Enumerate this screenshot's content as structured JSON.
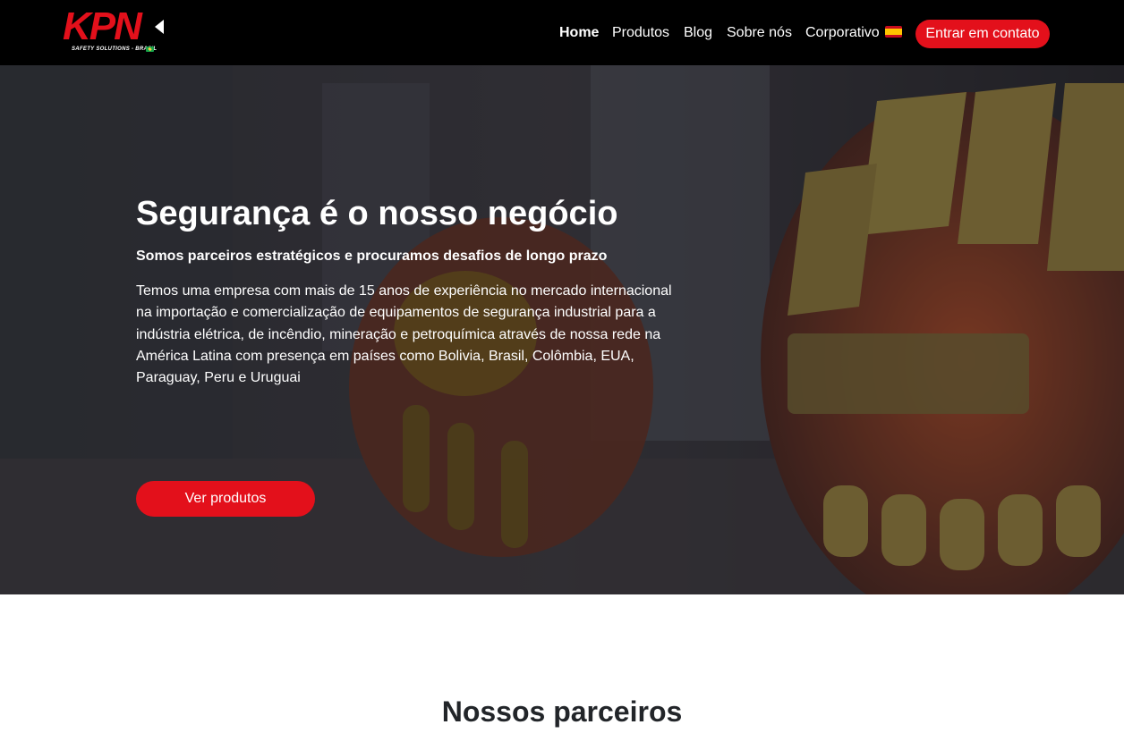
{
  "brand": {
    "logo_text": "KPN",
    "logo_tagline": "SAFETY SOLUTIONS - BRASIL",
    "primary_color": "#e3101b",
    "nav_background": "#000000"
  },
  "nav": {
    "items": [
      {
        "label": "Home",
        "active": true
      },
      {
        "label": "Produtos",
        "active": false
      },
      {
        "label": "Blog",
        "active": false
      },
      {
        "label": "Sobre nós",
        "active": false
      },
      {
        "label": "Corporativo",
        "active": false,
        "icon": "spain-flag-icon"
      }
    ],
    "cta_label": "Entrar em contato"
  },
  "hero": {
    "title": "Segurança é o nosso negócio",
    "subtitle": "Somos parceiros estratégicos e procuramos desafios de longo prazo",
    "body": "Temos uma empresa com mais de 15 anos de experiência no mercado internacional na importação e comercialização de equipamentos de segurança industrial para a indústria elétrica, de incêndio, mineração e petroquímica através de nossa rede na América Latina com presença em países como Bolivia, Brasil, Colômbia, EUA, Paraguay, Peru e Uruguai",
    "button_label": "Ver produtos",
    "background_image": "safety-gloves-photo"
  },
  "partners": {
    "title": "Nossos parceiros"
  }
}
